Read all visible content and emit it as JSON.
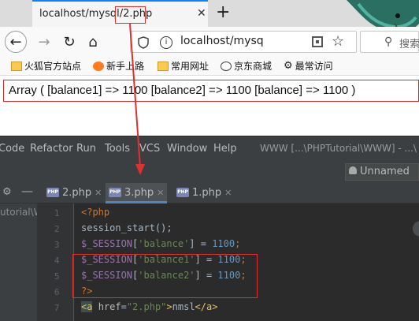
{
  "browser": {
    "tab_title": "localhost/mysql/2.php",
    "tab_close": "✕",
    "new_tab": "+",
    "url": "localhost/mysq",
    "search_label": "搜索",
    "bookmarks": [
      {
        "label": "火狐官方站点",
        "icon": "folder-icon"
      },
      {
        "label": "新手上路",
        "icon": "firefox-icon"
      },
      {
        "label": "常用网址",
        "icon": "folder-icon"
      },
      {
        "label": "京东商城",
        "icon": "globe-icon"
      },
      {
        "label": "最常访问",
        "icon": "gear-icon"
      }
    ],
    "output": "Array ( [balance1] => 1100 [balance2] => 1100 [balance] => 1100 )"
  },
  "ide": {
    "menu": [
      "Code",
      "Refactor",
      "Run",
      "Tools",
      "VCS",
      "Window",
      "Help"
    ],
    "title": "WWW [...\\PHPTutorial\\WWW] - ...\\",
    "project_combo": "Unnamed",
    "project_path": "utorial\\W",
    "tabs": [
      {
        "label": "2.php",
        "active": false
      },
      {
        "label": "3.php",
        "active": true
      },
      {
        "label": "1.php",
        "active": false
      }
    ],
    "line_numbers": [
      "1",
      "2",
      "3",
      "4",
      "5",
      "6",
      "7"
    ],
    "code": {
      "l1": "<?php",
      "l2": "session_start();",
      "l3_var": "$_SESSION",
      "l3_key": "'balance'",
      "l3_val": "1100",
      "l4_var": "$_SESSION",
      "l4_key": "'balance1'",
      "l4_val": "1100",
      "l5_var": "$_SESSION",
      "l5_key": "'balance2'",
      "l5_val": "1100",
      "l6": "?>",
      "l7_open": "<a",
      "l7_attr": "href",
      "l7_href": "\"2.php\"",
      "l7_text": "nmsl",
      "l7_close": "</a>"
    }
  },
  "colors": {
    "annotation": "#e03131",
    "ide_bg": "#2b2b2b"
  }
}
